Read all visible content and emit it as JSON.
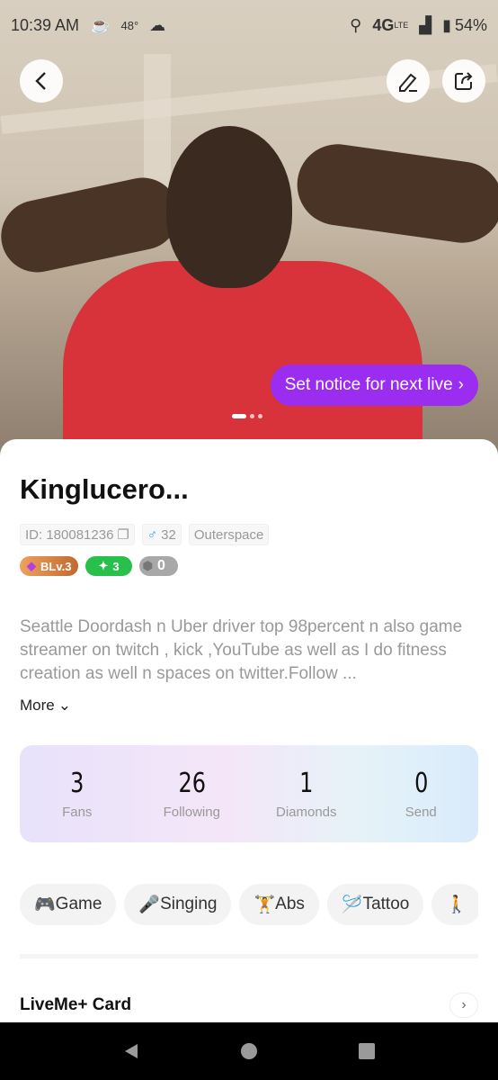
{
  "status_bar": {
    "time": "10:39 AM",
    "temp": "48°",
    "network": "4G",
    "network_sub": "LTE",
    "battery": "54%"
  },
  "header": {
    "back_icon": "chevron-left-icon",
    "edit_icon": "pencil-icon",
    "share_icon": "share-icon"
  },
  "photo": {
    "notice_label": "Set notice for next live",
    "notice_chevron": "›",
    "page_count": 3,
    "current_page": 1
  },
  "profile": {
    "name": "Kinglucero...",
    "id": "ID: 180081236",
    "gender_symbol": "♂",
    "age": "32",
    "location": "Outerspace",
    "badges": [
      {
        "label": "BLv.3",
        "color": "#c97a3c"
      },
      {
        "label": "3",
        "color": "#28c04a"
      },
      {
        "label": "0",
        "color": "#a8a8a8"
      }
    ],
    "bio": "Seattle Doordash n Uber driver top 98percent n also game streamer on twitch , kick ,YouTube as well as I do fitness creation as well n spaces on twitter.Follow ...",
    "more_label": "More"
  },
  "stats": [
    {
      "value": "3",
      "label": "Fans"
    },
    {
      "value": "26",
      "label": "Following"
    },
    {
      "value": "1",
      "label": "Diamonds"
    },
    {
      "value": "0",
      "label": "Send"
    }
  ],
  "tags": [
    {
      "emoji": "🎮",
      "label": "Game"
    },
    {
      "emoji": "🎤",
      "label": "Singing"
    },
    {
      "emoji": "🏋",
      "label": "Abs"
    },
    {
      "emoji": "🪡",
      "label": "Tattoo"
    },
    {
      "emoji": "🚶",
      "label": ""
    }
  ],
  "liveme_card": {
    "title": "LiveMe+ Card"
  },
  "accent": "#9a2df0"
}
